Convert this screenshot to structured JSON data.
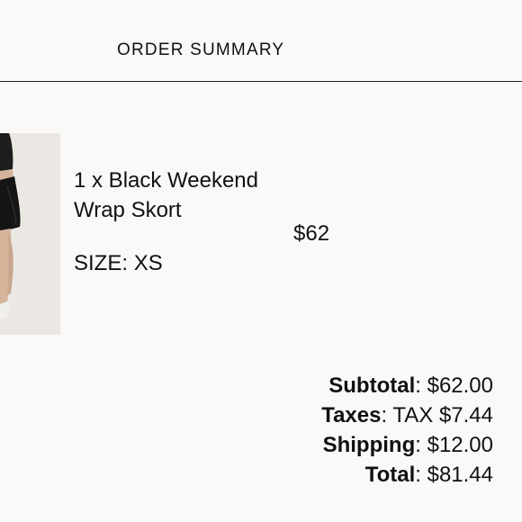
{
  "header": {
    "title": "ORDER SUMMARY"
  },
  "line_item": {
    "image_icon": "product-photo-skort",
    "name": "1 x Black Weekend Wrap Skort",
    "size_label": "SIZE:",
    "size_value": "XS",
    "price": "$62"
  },
  "totals": {
    "subtotal_label": "Subtotal",
    "subtotal_value": "$62.00",
    "taxes_label": "Taxes",
    "taxes_value": "TAX $7.44",
    "shipping_label": "Shipping",
    "shipping_value": "$12.00",
    "total_label": "Total",
    "total_value": "$81.44"
  }
}
